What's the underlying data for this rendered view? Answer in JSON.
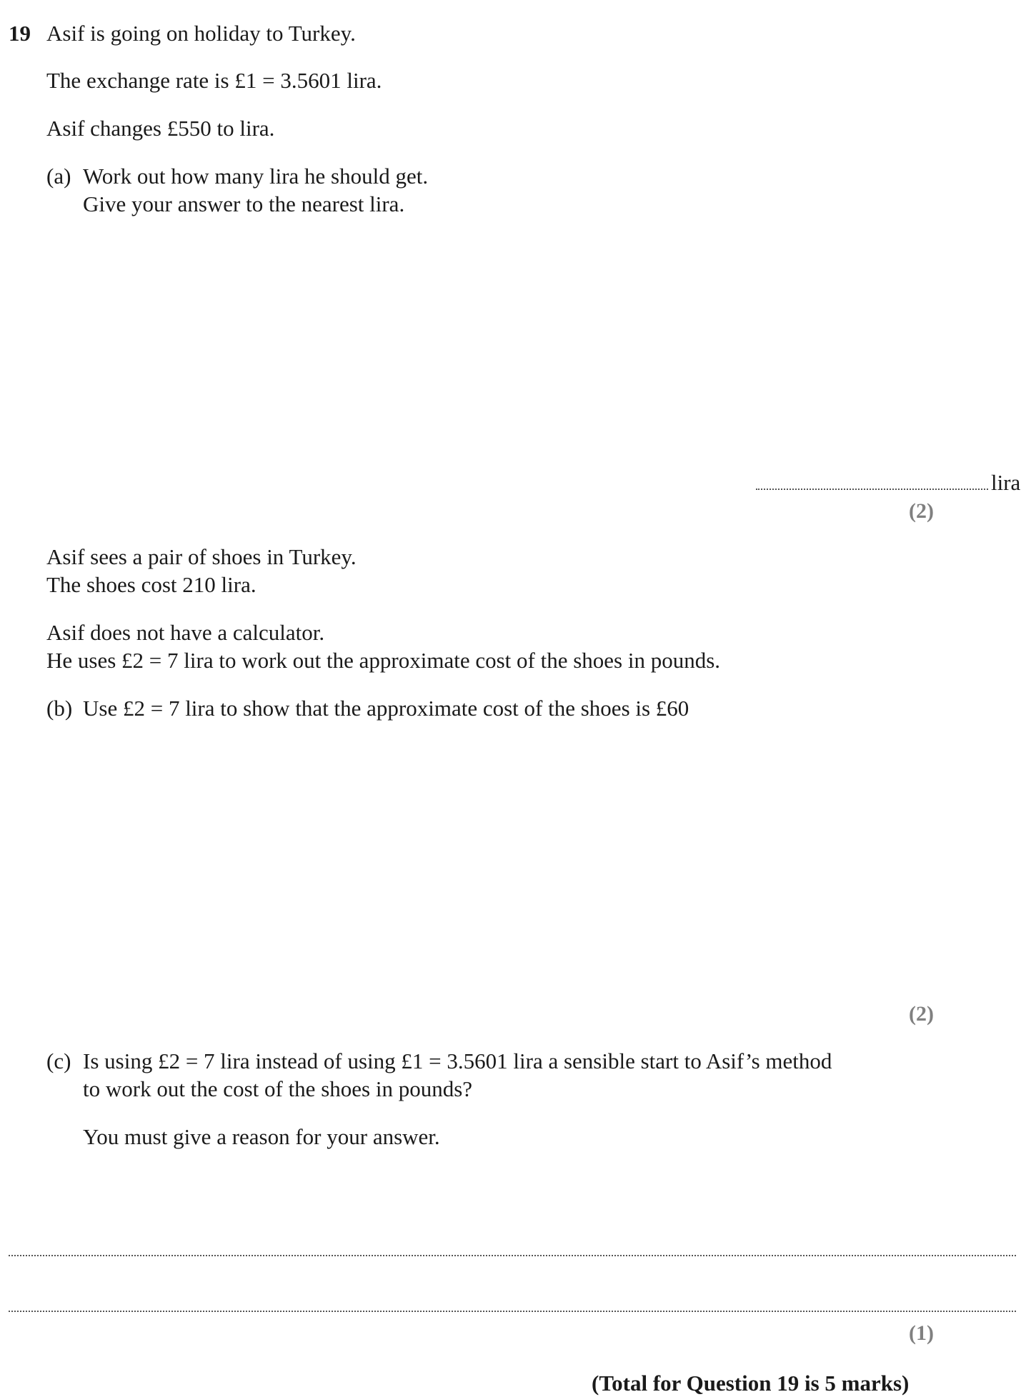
{
  "question": {
    "number": "19",
    "intro": "Asif is going on holiday to Turkey.",
    "rate": "The exchange rate is £1 = 3.5601 lira.",
    "change": "Asif changes £550 to lira."
  },
  "part_a": {
    "label": "(a)",
    "line1": "Work out how many lira he should get.",
    "line2": "Give your answer to the nearest lira.",
    "unit": "lira",
    "marks": "(2)"
  },
  "context": {
    "line1": "Asif sees a pair of shoes in Turkey.",
    "line2": "The shoes cost 210 lira.",
    "line3": "Asif does not have a calculator.",
    "line4": "He uses £2 = 7 lira to work out the approximate cost of the shoes in pounds."
  },
  "part_b": {
    "label": "(b)",
    "line1": "Use £2 = 7 lira to show that the approximate cost of the shoes is £60",
    "marks": "(2)"
  },
  "part_c": {
    "label": "(c)",
    "line1": "Is using £2 = 7 lira instead of using £1 = 3.5601 lira a sensible start to Asif’s method",
    "line2": "to work out the cost of the shoes in pounds?",
    "line3": "You must give a reason for your answer.",
    "marks": "(1)"
  },
  "total": "(Total for Question 19 is 5 marks)"
}
